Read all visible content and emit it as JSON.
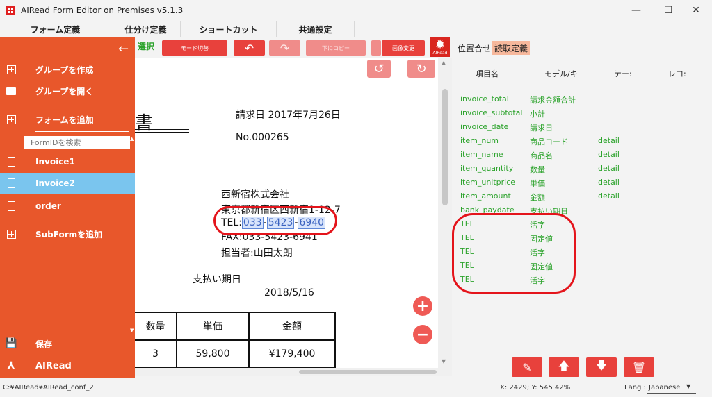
{
  "window": {
    "title": "AIRead Form Editor on Premises v5.1.3",
    "minimize": "—",
    "maximize": "☐",
    "close": "✕"
  },
  "menu": [
    "フォーム定義",
    "仕分け定義",
    "ショートカット",
    "共通設定"
  ],
  "toolbar": {
    "select_label": "選択",
    "mode_switch": "モード切替",
    "undo": "↶",
    "redo": "↷",
    "copy_below": "下にコピー",
    "image_change": "画像変更",
    "settings_caption": "AIRead"
  },
  "drawer": {
    "back": "←",
    "create_group": "グループを作成",
    "open_group": "グループを開く",
    "add_form": "フォームを追加",
    "search_placeholder": "FormIDを検索",
    "forms": [
      "Invoice1",
      "Invoice2",
      "order"
    ],
    "add_subform": "SubFormを追加",
    "save": "保存",
    "brand": "AIRead"
  },
  "document": {
    "heading_fragment": "書",
    "invoice_date": "請求日  2017年7月26日",
    "invoice_no": "No.000265",
    "company": "西新宿株式会社",
    "address": "東京都新宿区西新宿1-12-7",
    "tel_label": "TEL:",
    "tel_parts": [
      "033",
      "5423",
      "6940"
    ],
    "fax": "FAX:033-5423-6941",
    "contact": "担当者:山田太朗",
    "due_label": "支払い期日",
    "due_date": "2018/5/16",
    "table_headers": [
      "数量",
      "単価",
      "金額"
    ],
    "table_row": [
      "3",
      "59,800",
      "¥179,400"
    ],
    "rotate_left": "↺",
    "rotate_right": "↻",
    "zoom_in": "+",
    "zoom_out": "−"
  },
  "right_panel": {
    "tabs": [
      "位置合せ",
      "読取定義"
    ],
    "headers": [
      "項目名",
      "モデル/キ",
      "テー:",
      "レコ:"
    ],
    "rows": [
      [
        "invoice_total",
        "請求金額合計",
        ""
      ],
      [
        "invoice_subtotal",
        "小計",
        ""
      ],
      [
        "invoice_date",
        "請求日",
        ""
      ],
      [
        "item_num",
        "商品コード",
        "detail"
      ],
      [
        "item_name",
        "商品名",
        "detail"
      ],
      [
        "item_quantity",
        "数量",
        "detail"
      ],
      [
        "item_unitprice",
        "単価",
        "detail"
      ],
      [
        "item_amount",
        "金額",
        "detail"
      ],
      [
        "bank_paydate",
        "支払い期日",
        ""
      ],
      [
        "TEL",
        "活字",
        ""
      ],
      [
        "TEL",
        "固定値",
        ""
      ],
      [
        "TEL",
        "活字",
        ""
      ],
      [
        "TEL",
        "固定値",
        ""
      ],
      [
        "TEL",
        "活字",
        ""
      ]
    ],
    "buttons": [
      "edit-icon",
      "arrow-up-icon",
      "arrow-down-icon",
      "trash-icon"
    ]
  },
  "status": {
    "path": "C:¥AIRead¥AIRead_conf_2",
    "coords": "X: 2429; Y: 545  42%",
    "lang_label": "Lang :",
    "lang_value": "Japanese",
    "lang_arrow": "▼"
  },
  "colors": {
    "accent_red": "#e8413c",
    "drawer_orange": "#e8572b",
    "selected_blue": "#7ac5ee",
    "field_green": "#2ca32c",
    "annotation_red": "#e4141b"
  }
}
